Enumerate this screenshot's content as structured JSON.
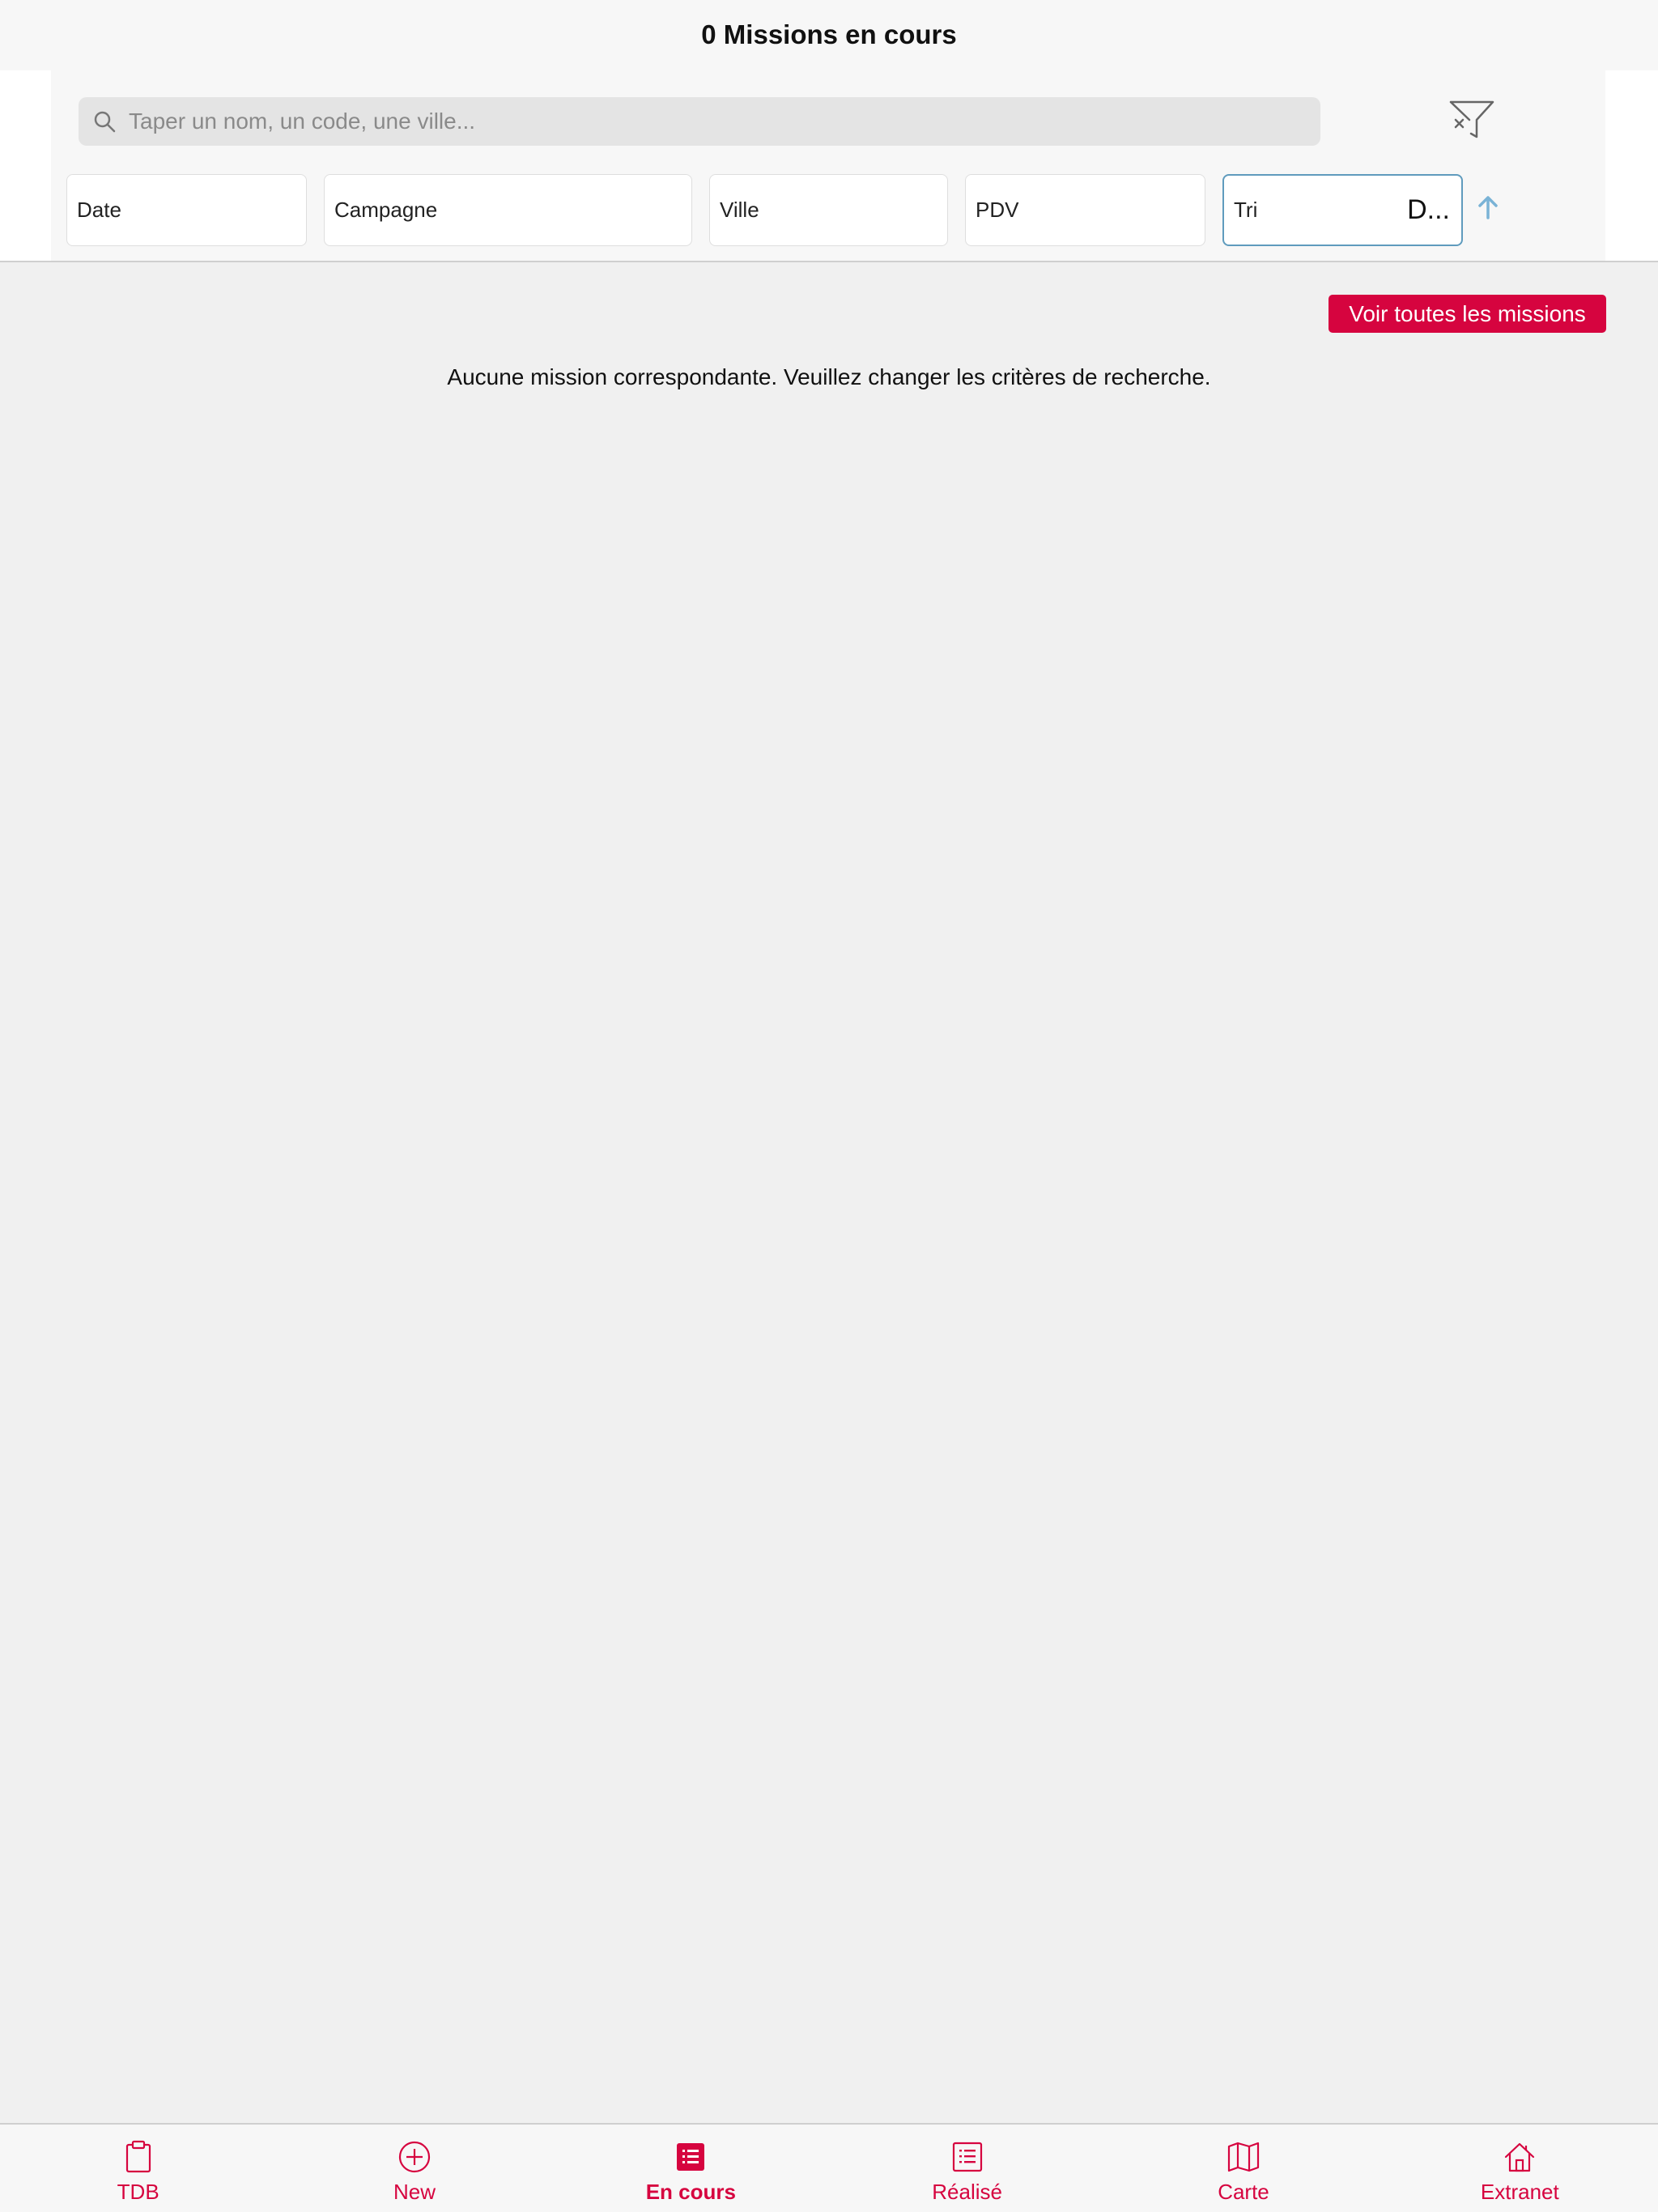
{
  "header": {
    "title": "0 Missions en cours"
  },
  "search": {
    "placeholder": "Taper un nom, un code, une ville...",
    "value": ""
  },
  "filters": {
    "date_label": "Date",
    "campaign_label": "Campagne",
    "city_label": "Ville",
    "pdv_label": "PDV",
    "sort_label": "Tri",
    "sort_value": "D...",
    "sort_direction": "ascending"
  },
  "actions": {
    "see_all_label": "Voir toutes les missions"
  },
  "content": {
    "empty_message": "Aucune mission correspondante. Veuillez changer les critères de recherche."
  },
  "colors": {
    "accent": "#d6043f",
    "sort_border": "#5f9bbd",
    "sort_arrow": "#7ab3d6"
  },
  "tabbar": {
    "active_index": 2,
    "tabs": [
      {
        "label": "TDB",
        "icon": "clipboard-icon"
      },
      {
        "label": "New",
        "icon": "plus-circle-icon"
      },
      {
        "label": "En cours",
        "icon": "list-filled-icon"
      },
      {
        "label": "Réalisé",
        "icon": "list-outline-icon"
      },
      {
        "label": "Carte",
        "icon": "map-icon"
      },
      {
        "label": "Extranet",
        "icon": "home-icon"
      }
    ]
  }
}
